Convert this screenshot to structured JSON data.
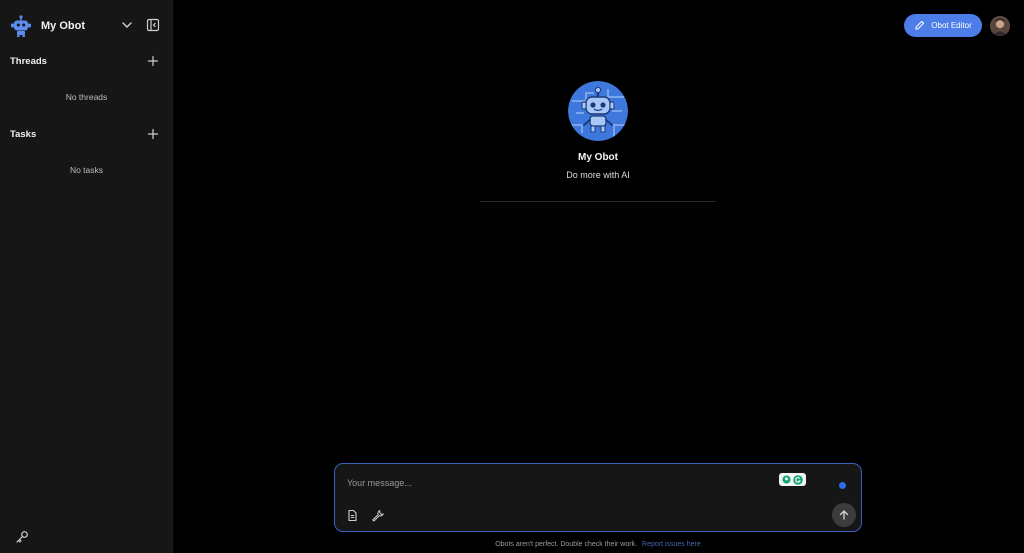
{
  "sidebar": {
    "app_name": "My Obot",
    "threads": {
      "title": "Threads",
      "empty": "No threads"
    },
    "tasks": {
      "title": "Tasks",
      "empty": "No tasks"
    }
  },
  "header": {
    "editor_label": "Obot Editor"
  },
  "bot": {
    "name": "My Obot",
    "description": "Do more with AI"
  },
  "composer": {
    "placeholder": "Your message..."
  },
  "footer": {
    "note": "Obots aren't perfect. Double check their work.",
    "link": "Report issues here"
  },
  "colors": {
    "accent": "#4d7de8",
    "border_accent": "#3b5fbf",
    "sidebar_bg": "#161616",
    "link": "#4666b0"
  },
  "icons": [
    "robot-logo-icon",
    "chevron-down-icon",
    "sidebar-collapse-icon",
    "plus-icon",
    "key-icon",
    "pencil-icon",
    "file-icon",
    "wrench-icon",
    "arrow-up-icon"
  ]
}
